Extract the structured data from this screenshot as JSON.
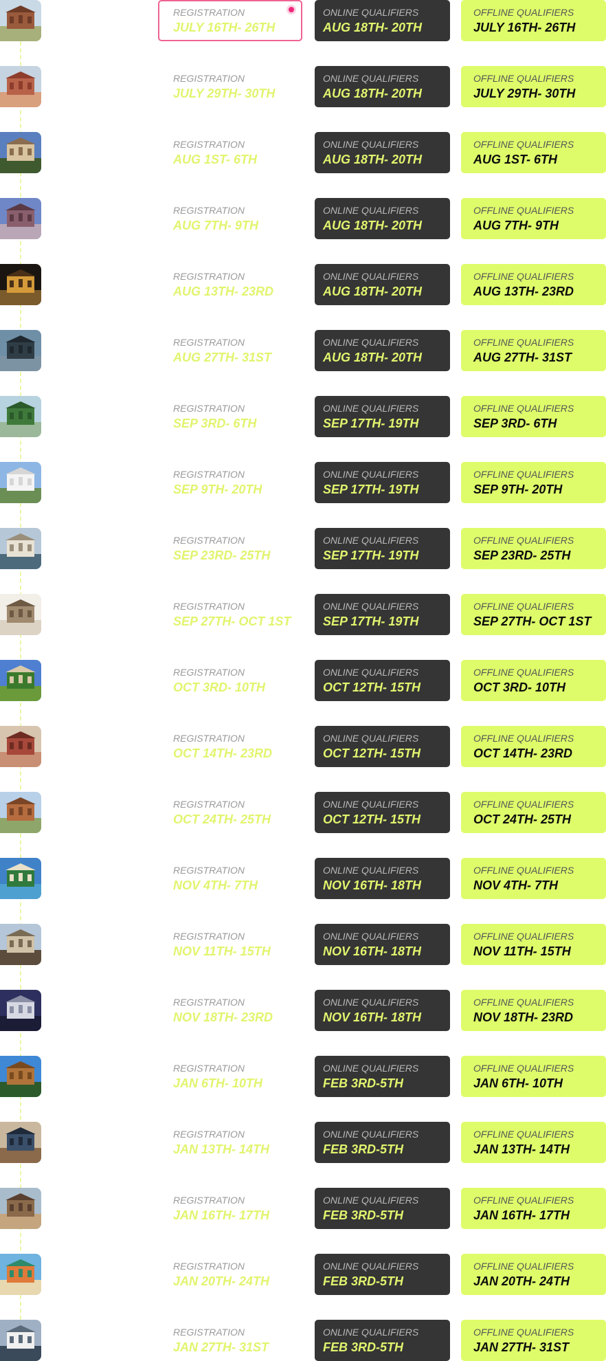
{
  "labels": {
    "registration": "REGISTRATION",
    "online": "ONLINE QUALIFIERS",
    "offline": "OFFLINE QUALIFIERS"
  },
  "colors": {
    "accent_lime": "#defc6a",
    "registration_date": "#e2f46e",
    "online_card_bg": "#353535",
    "active_border": "#f06292",
    "active_dot": "#f0287b"
  },
  "rows": [
    {
      "thumb_icon": "fort-photo",
      "active": true,
      "registration": "JULY 16TH- 26TH",
      "online": "AUG 18TH- 20TH",
      "offline": "JULY 16TH- 26TH"
    },
    {
      "thumb_icon": "palace-photo",
      "active": false,
      "registration": "JULY 29TH- 30TH",
      "online": "AUG 18TH- 20TH",
      "offline": "JULY 29TH- 30TH"
    },
    {
      "thumb_icon": "chapel-photo",
      "active": false,
      "registration": "AUG 1ST- 6TH",
      "online": "AUG 18TH- 20TH",
      "offline": "AUG 1ST- 6TH"
    },
    {
      "thumb_icon": "tree-photo",
      "active": false,
      "registration": "AUG 7TH- 9TH",
      "online": "AUG 18TH- 20TH",
      "offline": "AUG 7TH- 9TH"
    },
    {
      "thumb_icon": "night-street-photo",
      "active": false,
      "registration": "AUG 13TH- 23RD",
      "online": "AUG 18TH- 20TH",
      "offline": "AUG 13TH- 23RD"
    },
    {
      "thumb_icon": "monument-hand-photo",
      "active": false,
      "registration": "AUG 27TH- 31ST",
      "online": "AUG 18TH- 20TH",
      "offline": "AUG 27TH- 31ST"
    },
    {
      "thumb_icon": "river-valley-photo",
      "active": false,
      "registration": "SEP 3RD- 6TH",
      "online": "SEP 17TH- 19TH",
      "offline": "SEP 3RD- 6TH"
    },
    {
      "thumb_icon": "lotus-temple-photo",
      "active": false,
      "registration": "SEP 9TH- 20TH",
      "online": "SEP 17TH- 19TH",
      "offline": "SEP 9TH- 20TH"
    },
    {
      "thumb_icon": "palace-lake-photo",
      "active": false,
      "registration": "SEP 23RD- 25TH",
      "online": "SEP 17TH- 19TH",
      "offline": "SEP 23RD- 25TH"
    },
    {
      "thumb_icon": "museum-dome-photo",
      "active": false,
      "registration": "SEP 27TH- OCT 1ST",
      "online": "SEP 17TH- 19TH",
      "offline": "SEP 27TH- OCT 1ST"
    },
    {
      "thumb_icon": "garden-temple-photo",
      "active": false,
      "registration": "OCT 3RD- 10TH",
      "online": "OCT 12TH- 15TH",
      "offline": "OCT 3RD- 10TH"
    },
    {
      "thumb_icon": "archway-photo",
      "active": false,
      "registration": "OCT 14TH- 23RD",
      "online": "OCT 12TH- 15TH",
      "offline": "OCT 14TH- 23RD"
    },
    {
      "thumb_icon": "stone-temple-photo",
      "active": false,
      "registration": "OCT 24TH- 25TH",
      "online": "OCT 12TH- 15TH",
      "offline": "OCT 24TH- 25TH"
    },
    {
      "thumb_icon": "coastline-photo",
      "active": false,
      "registration": "NOV 4TH- 7TH",
      "online": "NOV 16TH- 18TH",
      "offline": "NOV 4TH- 7TH"
    },
    {
      "thumb_icon": "charminar-photo",
      "active": false,
      "registration": "NOV 11TH- 15TH",
      "online": "NOV 16TH- 18TH",
      "offline": "NOV 11TH- 15TH"
    },
    {
      "thumb_icon": "modern-building-photo",
      "active": false,
      "registration": "NOV 18TH- 23RD",
      "online": "NOV 16TH- 18TH",
      "offline": "NOV 18TH- 23RD"
    },
    {
      "thumb_icon": "gopuram-photo",
      "active": false,
      "registration": "JAN 6TH- 10TH",
      "online": "FEB 3RD-5TH",
      "offline": "JAN 6TH- 10TH"
    },
    {
      "thumb_icon": "fishing-net-photo",
      "active": false,
      "registration": "JAN 13TH- 14TH",
      "online": "FEB 3RD-5TH",
      "offline": "JAN 13TH- 14TH"
    },
    {
      "thumb_icon": "hill-fort-photo",
      "active": false,
      "registration": "JAN 16TH- 17TH",
      "online": "FEB 3RD-5TH",
      "offline": "JAN 16TH- 17TH"
    },
    {
      "thumb_icon": "beach-boats-photo",
      "active": false,
      "registration": "JAN 20TH- 24TH",
      "online": "FEB 3RD-5TH",
      "offline": "JAN 20TH- 24TH"
    },
    {
      "thumb_icon": "sea-bridge-photo",
      "active": false,
      "registration": "JAN 27TH- 31ST",
      "online": "FEB 3RD-5TH",
      "offline": "JAN 27TH- 31ST"
    }
  ]
}
